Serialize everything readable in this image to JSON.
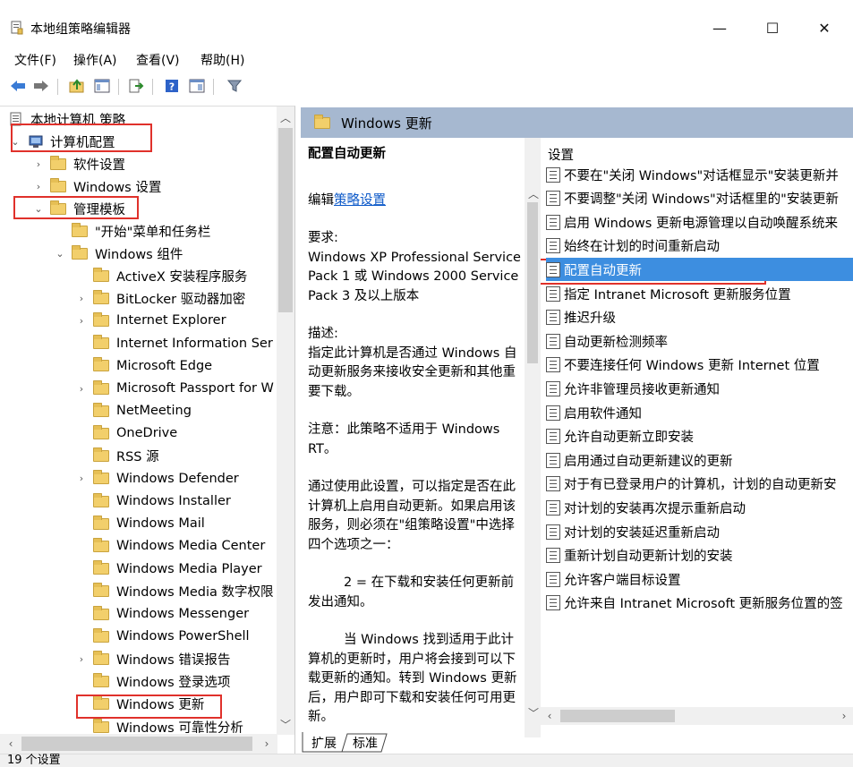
{
  "window": {
    "title": "本地组策略编辑器"
  },
  "menu": [
    "文件(F)",
    "操作(A)",
    "查看(V)",
    "帮助(H)"
  ],
  "toolbar_icons": [
    "back-icon",
    "forward-icon",
    "up-folder-icon",
    "show-tree-icon",
    "export-icon",
    "help-icon",
    "properties-icon",
    "filter-icon"
  ],
  "tree": {
    "root": "本地计算机 策略",
    "computer_config": "计算机配置",
    "software_settings": "软件设置",
    "windows_settings": "Windows 设置",
    "admin_templates": "管理模板",
    "start_menu": "\"开始\"菜单和任务栏",
    "windows_components": "Windows 组件",
    "items": [
      "ActiveX 安装程序服务",
      "BitLocker 驱动器加密",
      "Internet Explorer",
      "Internet Information Ser",
      "Microsoft Edge",
      "Microsoft Passport for W",
      "NetMeeting",
      "OneDrive",
      "RSS 源",
      "Windows Defender",
      "Windows Installer",
      "Windows Mail",
      "Windows Media Center",
      "Windows Media Player",
      "Windows Media 数字权限",
      "Windows Messenger",
      "Windows PowerShell",
      "Windows 错误报告",
      "Windows 登录选项",
      "Windows 更新",
      "Windows 可靠性分析"
    ]
  },
  "header": {
    "title": "Windows 更新"
  },
  "description": {
    "title": "配置自动更新",
    "edit_prefix": "编辑",
    "edit_link": "策略设置",
    "req_label": "要求:",
    "req_text": "Windows XP Professional Service Pack 1 或 Windows 2000 Service Pack 3 及以上版本",
    "desc_label": "描述:",
    "desc_text": "指定此计算机是否通过 Windows 自动更新服务来接收安全更新和其他重要下载。",
    "note": "注意：此策略不适用于 Windows RT。",
    "para1": "通过使用此设置，可以指定是否在此计算机上启用自动更新。如果启用该服务，则必须在\"组策略设置\"中选择四个选项之一：",
    "para2": "2 = 在下载和安装任何更新前发出通知。",
    "para3": "当 Windows 找到适用于此计算机的更新时，用户将会接到可以下载更新的通知。转到 Windows 更新后，用户即可下载和安装任何可用更新。"
  },
  "settings": {
    "header": "设置",
    "items": [
      "不要在\"关闭 Windows\"对话框显示\"安装更新并",
      "不要调整\"关闭 Windows\"对话框里的\"安装更新",
      "启用 Windows 更新电源管理以自动唤醒系统来",
      "始终在计划的时间重新启动",
      "配置自动更新",
      "指定 Intranet Microsoft 更新服务位置",
      "推迟升级",
      "自动更新检测频率",
      "不要连接任何 Windows 更新 Internet 位置",
      "允许非管理员接收更新通知",
      "启用软件通知",
      "允许自动更新立即安装",
      "启用通过自动更新建议的更新",
      "对于有已登录用户的计算机，计划的自动更新安",
      "对计划的安装再次提示重新启动",
      "对计划的安装延迟重新启动",
      "重新计划自动更新计划的安装",
      "允许客户端目标设置",
      "允许来自 Intranet Microsoft 更新服务位置的签"
    ],
    "selected_index": 4
  },
  "tabs": [
    "扩展",
    "标准"
  ],
  "status": "19 个设置",
  "colors": {
    "header_band": "#a6b8d0",
    "selection": "#3d8ee0",
    "highlight_box": "#e0312b",
    "link": "#0b58c8"
  }
}
